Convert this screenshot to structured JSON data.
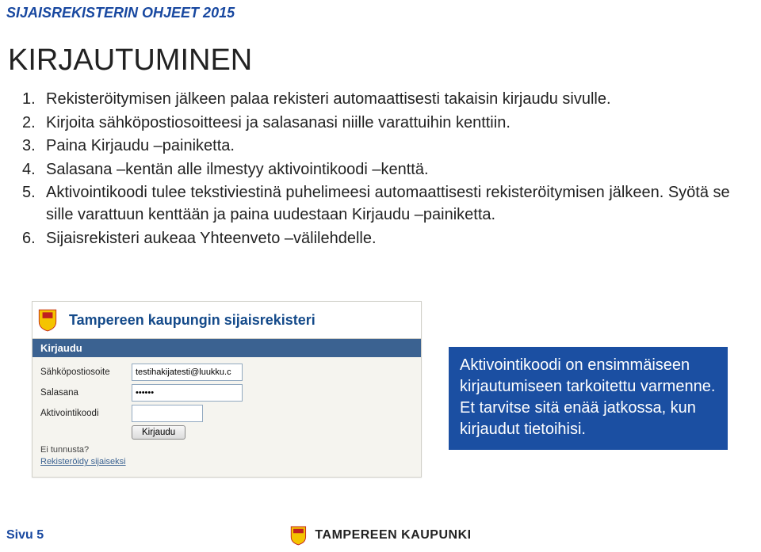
{
  "header": "SIJAISREKISTERIN OHJEET 2015",
  "title": "KIRJAUTUMINEN",
  "list": {
    "n1": "1.",
    "t1": "Rekisteröitymisen jälkeen palaa rekisteri automaattisesti takaisin kirjaudu sivulle.",
    "n2": "2.",
    "t2": "Kirjoita sähköpostiosoitteesi ja salasanasi niille varattuihin kenttiin.",
    "n3": "3.",
    "t3": "Paina Kirjaudu –painiketta.",
    "n4": "4.",
    "t4": "Salasana –kentän alle ilmestyy aktivointikoodi –kenttä.",
    "n5": "5.",
    "t5": "Aktivointikoodi tulee tekstiviestinä puhelimeesi automaattisesti rekisteröitymisen jälkeen. Syötä se sille varattuun kenttään ja paina uudestaan Kirjaudu –painiketta.",
    "n6": "6.",
    "t6": "Sijaisrekisteri aukeaa Yhteenveto –välilehdelle."
  },
  "screenshot": {
    "app_title": "Tampereen kaupungin sijaisrekisteri",
    "panel_title": "Kirjaudu",
    "email_label": "Sähköpostiosoite",
    "email_value": "testihakijatesti@luukku.c",
    "password_label": "Salasana",
    "password_value": "••••••",
    "code_label": "Aktivointikoodi",
    "button": "Kirjaudu",
    "forgot": "Ei tunnusta?",
    "register": "Rekisteröidy sijaiseksi"
  },
  "callout": "Aktivointikoodi on ensimmäiseen kirjautumiseen tarkoitettu varmenne. Et tarvitse sitä enää jatkossa, kun kirjaudut tietoihisi.",
  "footer": {
    "page": "Sivu 5",
    "brand": "TAMPEREEN KAUPUNKI"
  }
}
